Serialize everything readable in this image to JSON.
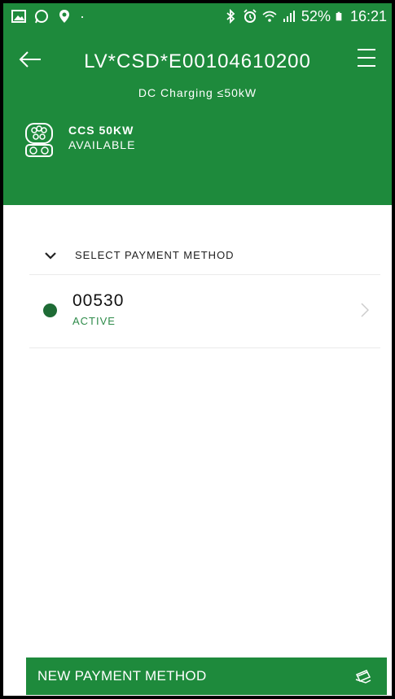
{
  "statusbar": {
    "battery": "52%",
    "time": "16:21"
  },
  "header": {
    "title": "LV*CSD*E00104610200",
    "subtitle": "DC Charging ≤50kW",
    "connector": {
      "name": "CCS 50KW",
      "status": "AVAILABLE"
    }
  },
  "payment": {
    "section_label": "SELECT PAYMENT METHOD",
    "methods": [
      {
        "id": "00530",
        "status": "ACTIVE"
      }
    ]
  },
  "actions": {
    "new_payment_label": "NEW PAYMENT METHOD"
  },
  "colors": {
    "brand_green": "#1e8a3c",
    "dot_green": "#1e6b35",
    "status_text_green": "#2e8b4a"
  }
}
